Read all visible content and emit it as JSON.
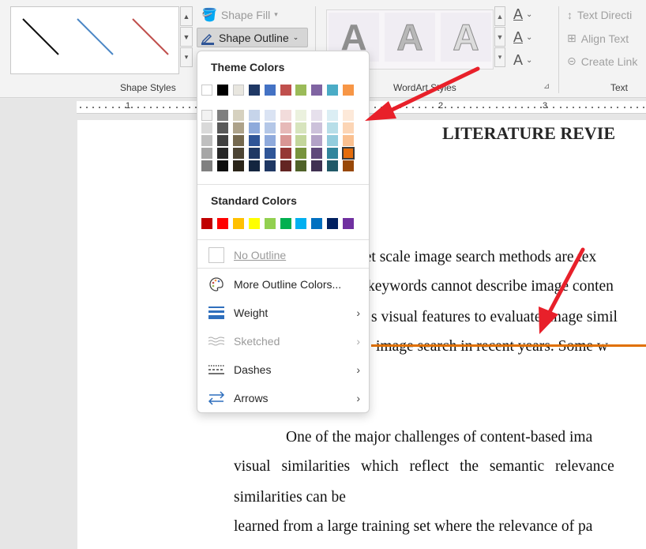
{
  "ribbon": {
    "shape_fill_label": "Shape Fill",
    "shape_outline_label": "Shape Outline",
    "shape_styles_group": "Shape Styles",
    "wordart_group": "WordArt Styles",
    "text_group": "Text",
    "text_direction_label": "Text Directi",
    "align_text_label": "Align Text",
    "create_link_label": "Create Link",
    "wordart_letter": "A"
  },
  "ruler": {
    "numbers": [
      "1",
      "2",
      "3"
    ]
  },
  "document": {
    "title": "LITERATURE REVIE",
    "lines": [
      "net scale image search methods are tex",
      "keywords cannot describe image conten",
      "s visual features to evaluate image simil",
      "image search in recent years. Some w",
      "One of the major challenges of content-based ima",
      "visual similarities which reflect the semantic relevance",
      "similarities can be",
      "learned from a large training set where the relevance of pa"
    ]
  },
  "dropdown": {
    "theme_colors_header": "Theme Colors",
    "standard_colors_header": "Standard Colors",
    "items": {
      "no_outline": "No Outline",
      "more_colors": "More Outline Colors...",
      "weight": "Weight",
      "sketched": "Sketched",
      "dashes": "Dashes",
      "arrows": "Arrows"
    },
    "theme_top_row": [
      "#ffffff",
      "#000000",
      "#e8e6df",
      "#1f3864",
      "#4472c4",
      "#c0504d",
      "#9bbb59",
      "#8064a2",
      "#4bacc6",
      "#f79646"
    ],
    "theme_shades": [
      [
        "#f2f2f2",
        "#d9d9d9",
        "#bfbfbf",
        "#a6a6a6",
        "#808080"
      ],
      [
        "#7f7f7f",
        "#595959",
        "#404040",
        "#262626",
        "#0d0d0d"
      ],
      [
        "#d6d1bf",
        "#ada28a",
        "#75694f",
        "#4c4434",
        "#2b2519"
      ],
      [
        "#c6d4ea",
        "#8eaadb",
        "#2f5597",
        "#1f3864",
        "#14253f"
      ],
      [
        "#dae3f3",
        "#b4c7e7",
        "#8faadc",
        "#2f5597",
        "#1f3864"
      ],
      [
        "#f2dcdb",
        "#e6b9b8",
        "#d99694",
        "#953735",
        "#632523"
      ],
      [
        "#ebf1de",
        "#d7e4bd",
        "#c3d69b",
        "#77933c",
        "#4f6228"
      ],
      [
        "#e6e0ec",
        "#ccc1da",
        "#b3a2c7",
        "#604a7b",
        "#403152"
      ],
      [
        "#dbeef4",
        "#b7dee8",
        "#93cddd",
        "#31859c",
        "#215968"
      ],
      [
        "#fde9d9",
        "#fcd5b5",
        "#fac090",
        "#e46c0a",
        "#984807"
      ]
    ],
    "standard_colors": [
      "#c00000",
      "#ff0000",
      "#ffc000",
      "#ffff00",
      "#92d050",
      "#00b050",
      "#00b0f0",
      "#0070c0",
      "#002060",
      "#7030a0"
    ]
  },
  "colors": {
    "outline_accent": "#e07000",
    "annotation_arrow": "#e8202a"
  }
}
